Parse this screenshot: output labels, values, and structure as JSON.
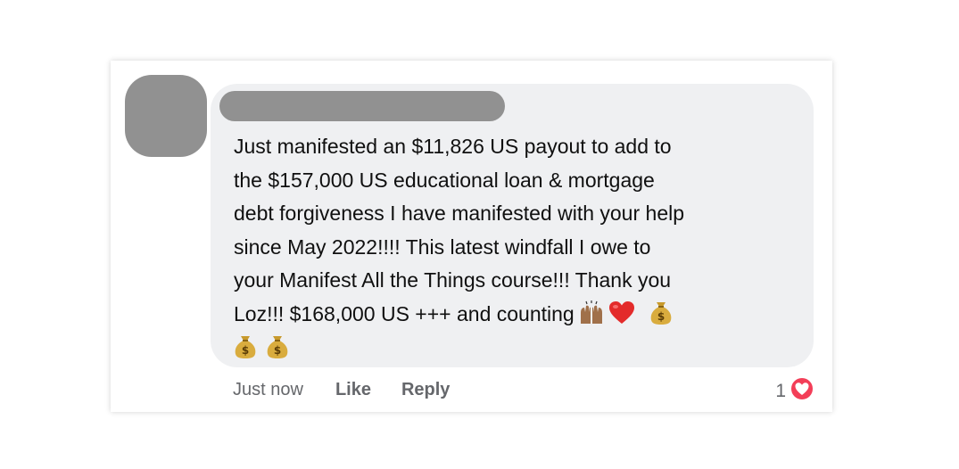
{
  "comment": {
    "text_lines": [
      "Just manifested an $11,826 US payout to add to",
      "the $157,000 US educational loan & mortgage",
      "debt forgiveness I have manifested with your help",
      "since May 2022!!!! This latest windfall I owe to",
      "your Manifest All the Things course!!! Thank you",
      "Loz!!!  $168,000 US +++ and counting"
    ],
    "emojis": [
      "raising-hands-icon",
      "red-heart-icon",
      "money-bag-icon",
      "money-bag-icon",
      "money-bag-icon"
    ]
  },
  "actions": {
    "timestamp": "Just now",
    "like_label": "Like",
    "reply_label": "Reply"
  },
  "reactions": {
    "count": "1",
    "type": "love-icon"
  },
  "colors": {
    "bubble": "#eff0f2",
    "redaction": "#919191",
    "action_text": "#65676b",
    "love_reaction": "#f33e58"
  }
}
